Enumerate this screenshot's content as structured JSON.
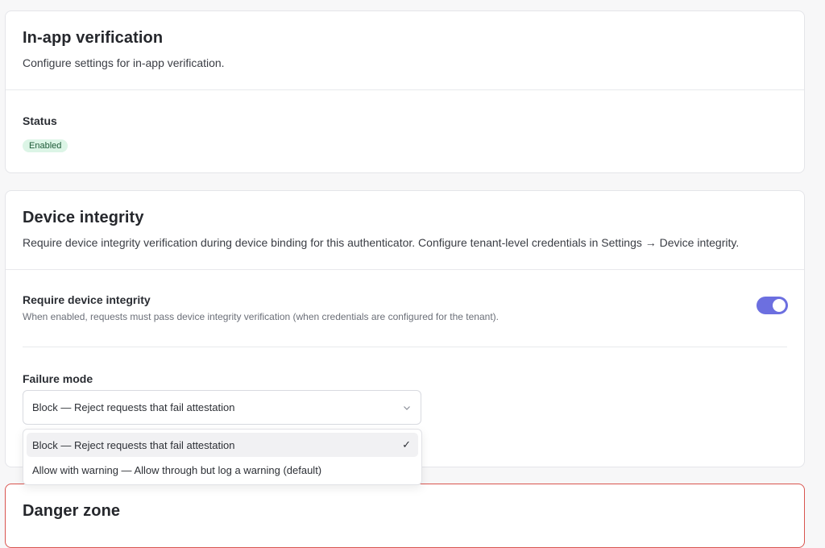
{
  "inapp": {
    "title": "In-app verification",
    "description": "Configure settings for in-app verification.",
    "status_label": "Status",
    "status_value": "Enabled"
  },
  "device": {
    "title": "Device integrity",
    "description": "Require device integrity verification during device binding for this authenticator. Configure tenant-level credentials in Settings → Device integrity.",
    "require_label": "Require device integrity",
    "require_hint": "When enabled, requests must pass device integrity verification (when credentials are configured for the tenant).",
    "require_enabled": true,
    "failure_label": "Failure mode",
    "failure_selected": "Block — Reject requests that fail attestation",
    "failure_options": [
      "Block — Reject requests that fail attestation",
      "Allow with warning — Allow through but log a warning (default)"
    ],
    "check_glyph": "✓"
  },
  "danger": {
    "title": "Danger zone"
  },
  "colors": {
    "toggle_on": "#6c6fe0",
    "badge_bg": "#dcf5e6",
    "danger_border": "#d9544f"
  },
  "icons": {
    "select_chevron": "chevron-down-icon",
    "selected_check": "check-icon"
  }
}
